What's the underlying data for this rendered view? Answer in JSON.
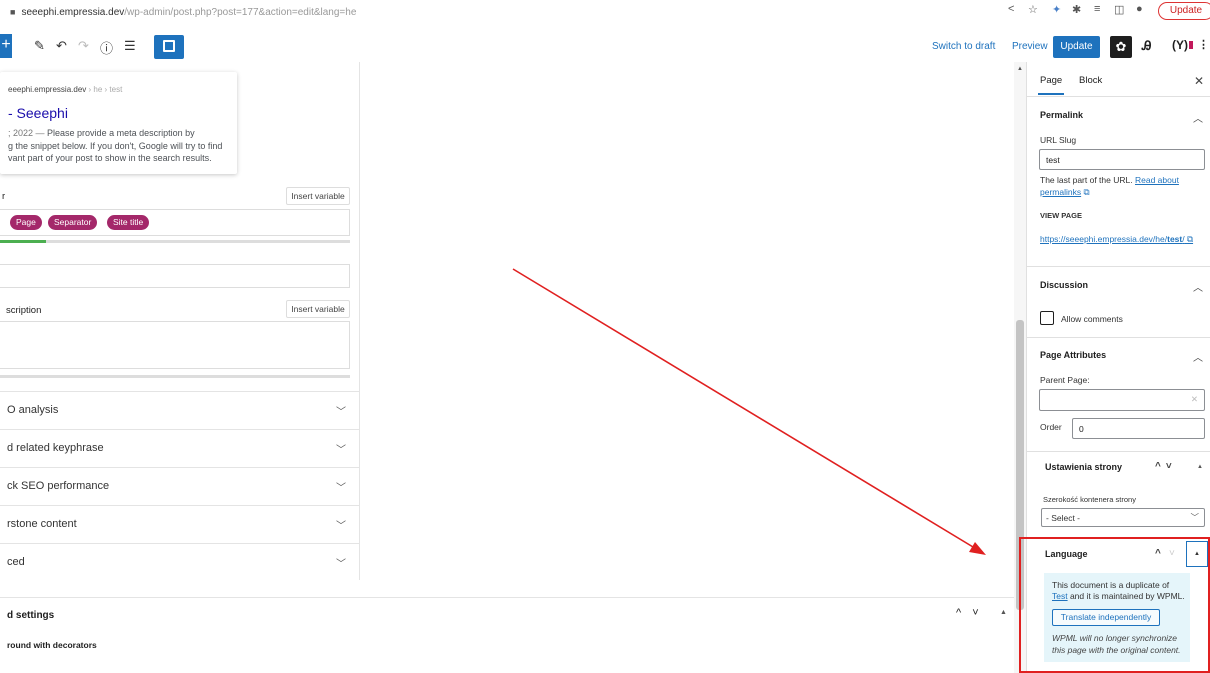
{
  "browser": {
    "url_host": "seeephi.empressia.dev",
    "url_path": "/wp-admin/post.php?post=177&action=edit&lang=he",
    "update_label": "Update"
  },
  "toolbar": {
    "switch_to_draft": "Switch to draft",
    "preview": "Preview",
    "update": "Update",
    "yoast": "(Y)"
  },
  "yoast": {
    "snippet": {
      "url_main": "eeephi.empressia.dev",
      "url_tail": " › he › test",
      "title": "- Seeephi",
      "desc_date": "; 2022 — ",
      "desc_lines": [
        "Please provide a meta description by",
        "g the snippet below. If you don't, Google will try to find",
        "vant part of your post to show in the search results."
      ]
    },
    "seo_title_label": "r",
    "insert_variable": "Insert variable",
    "variables": [
      "Page",
      "Separator",
      "Site title"
    ],
    "title_progress": 0.13,
    "meta_desc_label": "scription",
    "collapsibles": [
      "O analysis",
      "d related keyphrase",
      "ck SEO performance",
      "rstone content",
      "ced"
    ]
  },
  "advanced": {
    "title": "d settings",
    "subtitle": "round with decorators"
  },
  "sidebar": {
    "tabs": [
      "Page",
      "Block"
    ],
    "permalink": {
      "heading": "Permalink",
      "slug_label": "URL Slug",
      "slug_value": "test",
      "help_text": "The last part of the URL.",
      "read_about": "Read about",
      "permalinks": "permalinks",
      "view_page": "VIEW PAGE",
      "url_start": "https://seeephi.empressia.dev/he/",
      "url_bold": "test",
      "url_end": "/"
    },
    "discussion": {
      "heading": "Discussion",
      "allow_comments": "Allow comments",
      "checked": false
    },
    "page_attributes": {
      "heading": "Page Attributes",
      "parent_label": "Parent Page:",
      "order_label": "Order",
      "order_value": "0"
    },
    "ustawienia": {
      "heading": "Ustawienia strony",
      "width_label": "Szerokość kontenera strony",
      "select_value": "- Select -"
    },
    "language": {
      "heading": "Language",
      "notice_prefix": "This document is a duplicate of",
      "notice_link": "Test",
      "notice_suffix": " and it is maintained by WPML.",
      "translate_button": "Translate independently",
      "italic_line1": "WPML will no longer synchronize",
      "italic_line2": "this page with the original content."
    }
  },
  "colors": {
    "accent": "#1e72bd",
    "yoast_pill": "#a4286a",
    "progress": "#4caf50",
    "annotation": "#e02020",
    "notice_bg": "#e5f5fa"
  }
}
